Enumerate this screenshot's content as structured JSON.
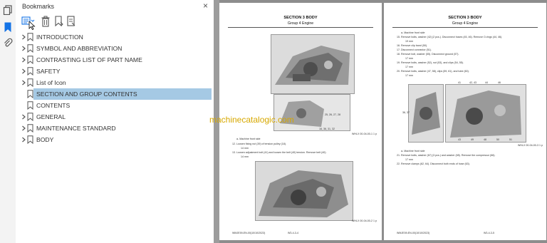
{
  "panel": {
    "title": "Bookmarks",
    "close": "×"
  },
  "bookmarks": [
    {
      "label": "INTRODUCTION",
      "expandable": true,
      "selected": false
    },
    {
      "label": "SYMBOL AND ABBREVIATION",
      "expandable": true,
      "selected": false
    },
    {
      "label": "CONTRASTING LIST OF PART NAME",
      "expandable": true,
      "selected": false
    },
    {
      "label": "SAFETY",
      "expandable": true,
      "selected": false
    },
    {
      "label": "List of Icon",
      "expandable": true,
      "selected": false
    },
    {
      "label": "SECTION AND GROUP CONTENTS",
      "expandable": false,
      "selected": true
    },
    {
      "label": "CONTENTS",
      "expandable": false,
      "selected": false
    },
    {
      "label": "GENERAL",
      "expandable": true,
      "selected": false
    },
    {
      "label": "MAINTENANCE STANDARD",
      "expandable": true,
      "selected": false
    },
    {
      "label": "BODY",
      "expandable": true,
      "selected": false
    }
  ],
  "left_page": {
    "section": "SECTION 3 BODY",
    "group": "Group 4 Engine",
    "callouts": [
      "25, 26, 27, 28",
      "16, 36, 31, 32"
    ],
    "step_a": "a-  Machine front side",
    "step_12": "12. Loosen fixing nut (39) of tension pulley (18).",
    "torque_12": "14 mm",
    "step_13": "13. Loosen adjustment bolt (41) and loosen the belt (40) tension. Remove belt (40).",
    "torque_13": "14 mm",
    "fig1_ref": "WHLX 00-04-00-1 1 p",
    "fig2_ref": "WHLX 00-04-00-2 1 p",
    "footer_left": "WMJE59-EN-00(10/10/2023)",
    "footer_center": "W3-4-3-4"
  },
  "right_page": {
    "section": "SECTION 3 BODY",
    "group": "Group 4 Engine",
    "lines": [
      "a-  Machine front side",
      "15. Remove bolts, washer (42) (2 pcs.). Disconnect hoses (45, 46). Remove O-rings (44, 46).",
      "19 mm",
      "16. Remove clip band (50).",
      "17. Disconnect connector (51).",
      "18. Remove bolt, washer (55). Disconnect ground (57).",
      "17 mm",
      "19. Remove bolts, washer (52), nut (53), and clips (54, 55).",
      "17 mm",
      "20. Remove bolts, washer (47, 58), clips (59, 61), and tube (60).",
      "17 mm"
    ],
    "labels_top": [
      "41",
      "42, 43",
      "44",
      "46"
    ],
    "labels_bottom": [
      "43",
      "49",
      "48",
      "50",
      "51"
    ],
    "left_label": "36, 37",
    "lines2": [
      "a-  Machine front side",
      "21. Remove bolts, washer (67) (3 pcs.) and washer (65). Remove the compressor (66).",
      "17 mm",
      "22. Remove clamps (62, 64). Disconnect both ends of hose (63)."
    ],
    "fig_ref": "WHLX 00-04-00-3 1 p",
    "footer_left": "WMJE59-EN-00(10/10/2023)",
    "footer_center": "W3-4-3-5"
  },
  "watermark": "machinecatalogic.com"
}
